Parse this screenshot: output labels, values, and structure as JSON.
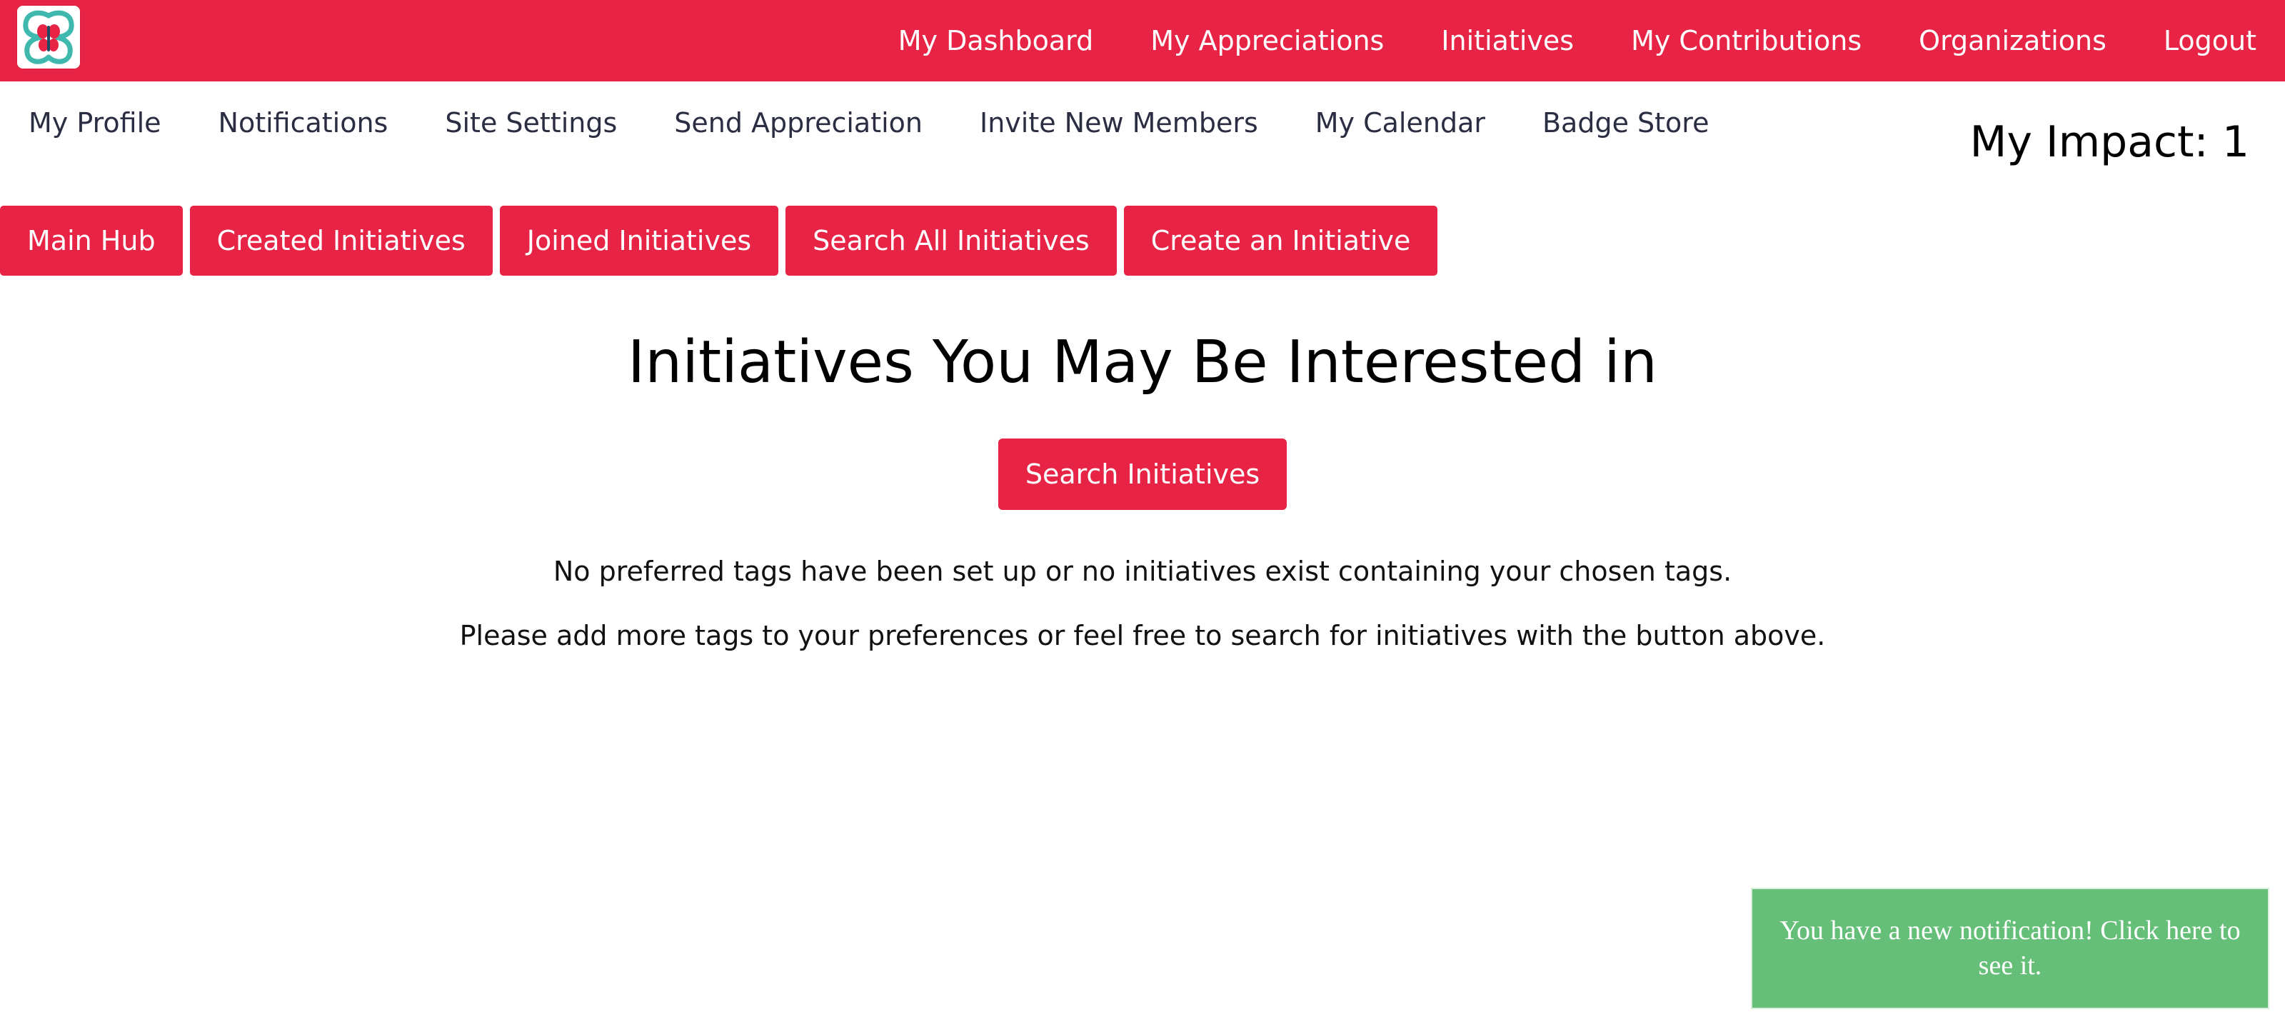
{
  "brand": {
    "logo_icon": "butterfly-logo-icon",
    "primary_color": "#e82446",
    "toast_color": "#66bf78"
  },
  "top_nav": {
    "links": [
      {
        "label": "My Dashboard"
      },
      {
        "label": "My Appreciations"
      },
      {
        "label": "Initiatives"
      },
      {
        "label": "My Contributions"
      },
      {
        "label": "Organizations"
      },
      {
        "label": "Logout"
      }
    ]
  },
  "sub_nav": {
    "links": [
      {
        "label": "My Profile"
      },
      {
        "label": "Notifications"
      },
      {
        "label": "Site Settings"
      },
      {
        "label": "Send Appreciation"
      },
      {
        "label": "Invite New Members"
      },
      {
        "label": "My Calendar"
      },
      {
        "label": "Badge Store"
      }
    ],
    "impact": "My Impact: 1"
  },
  "tabs": [
    {
      "label": "Main Hub"
    },
    {
      "label": "Created Initiatives"
    },
    {
      "label": "Joined Initiatives"
    },
    {
      "label": "Search All Initiatives"
    },
    {
      "label": "Create an Initiative"
    }
  ],
  "main": {
    "title": "Initiatives You May Be Interested in",
    "search_button": "Search Initiatives",
    "message_1": "No preferred tags have been set up or no initiatives exist containing your chosen tags.",
    "message_2": "Please add more tags to your preferences or feel free to search for initiatives with the button above."
  },
  "toast": {
    "text": "You have a new notification! Click here to see it."
  }
}
